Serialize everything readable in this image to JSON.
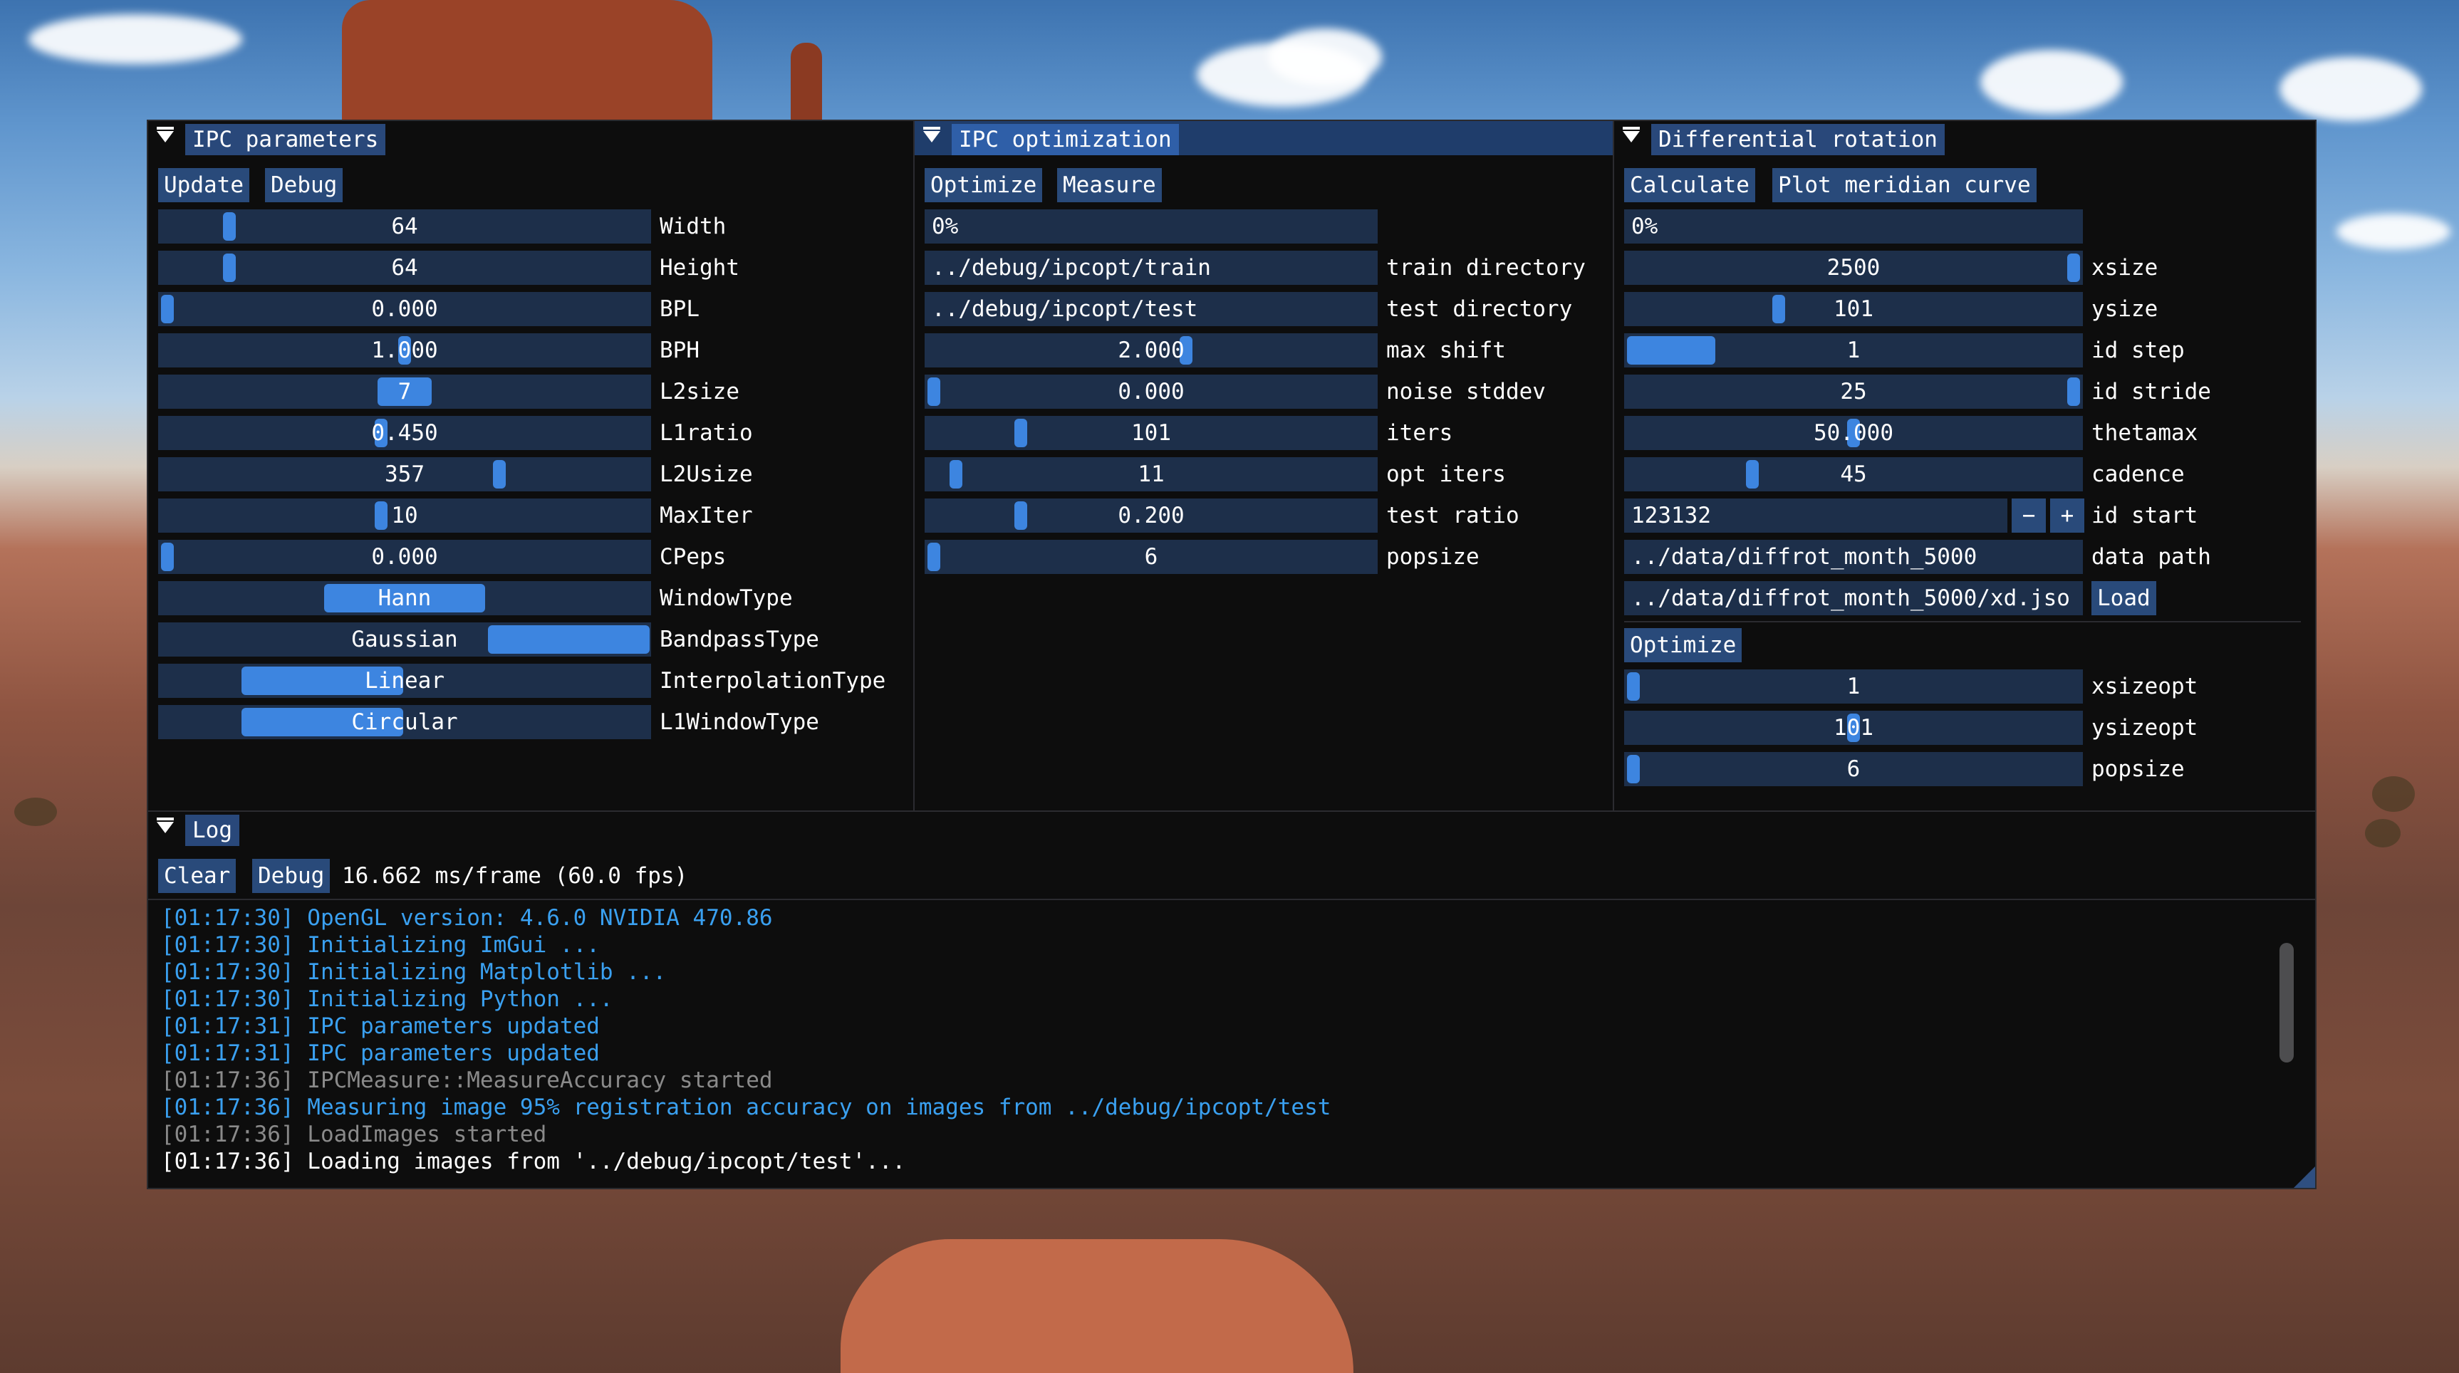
{
  "colors": {
    "accent": "#3d85e0",
    "frame": "#1d2f4a",
    "button": "#294a7a",
    "tab_active": "#2f5fa8",
    "log_info": "#3aa0f0",
    "log_gray": "#8a8a8a",
    "log_white": "#ffffff"
  },
  "ipc_parameters": {
    "title": "IPC parameters",
    "buttons": [
      "Update",
      "Debug"
    ],
    "rows": [
      {
        "value": "64",
        "label": "Width",
        "kind": "slider",
        "level": 0.13
      },
      {
        "value": "64",
        "label": "Height",
        "kind": "slider",
        "level": 0.13
      },
      {
        "value": "0.000",
        "label": "BPL",
        "kind": "slider",
        "level": 0.0
      },
      {
        "value": "1.000",
        "label": "BPH",
        "kind": "slider",
        "level": 0.5
      },
      {
        "value": "7",
        "label": "L2size",
        "kind": "combo_small",
        "level": 0.5
      },
      {
        "value": "0.450",
        "label": "L1ratio",
        "kind": "slider",
        "level": 0.45
      },
      {
        "value": "357",
        "label": "L2Usize",
        "kind": "slider",
        "level": 0.7
      },
      {
        "value": "10",
        "label": "MaxIter",
        "kind": "slider",
        "level": 0.45
      },
      {
        "value": "0.000",
        "label": "CPeps",
        "kind": "slider",
        "level": 0.0
      },
      {
        "value": "Hann",
        "label": "WindowType",
        "kind": "segment",
        "segment": 1
      },
      {
        "value": "Gaussian",
        "label": "BandpassType",
        "kind": "segment",
        "segment": 2
      },
      {
        "value": "Linear",
        "label": "InterpolationType",
        "kind": "segment",
        "segment": 0.5
      },
      {
        "value": "Circular",
        "label": "L1WindowType",
        "kind": "segment",
        "segment": 0.5
      }
    ]
  },
  "ipc_optimization": {
    "title": "IPC optimization",
    "buttons": [
      "Optimize",
      "Measure"
    ],
    "progress": "0%",
    "rows": [
      {
        "value": "../debug/ipcopt/train",
        "label": "train directory",
        "kind": "text"
      },
      {
        "value": "../debug/ipcopt/test",
        "label": "test directory",
        "kind": "text"
      },
      {
        "value": "2.000",
        "label": "max shift",
        "kind": "slider",
        "level": 0.58
      },
      {
        "value": "0.000",
        "label": "noise stddev",
        "kind": "slider",
        "level": 0.0
      },
      {
        "value": "101",
        "label": "iters",
        "kind": "slider",
        "level": 0.2
      },
      {
        "value": "11",
        "label": "opt iters",
        "kind": "slider",
        "level": 0.05
      },
      {
        "value": "0.200",
        "label": "test ratio",
        "kind": "slider",
        "level": 0.2
      },
      {
        "value": "6",
        "label": "popsize",
        "kind": "slider",
        "level": 0.0
      }
    ]
  },
  "differential_rotation": {
    "title": "Differential rotation",
    "buttons": [
      "Calculate",
      "Plot meridian curve"
    ],
    "progress": "0%",
    "rows": [
      {
        "value": "2500",
        "label": "xsize",
        "kind": "slider",
        "level": 1.0
      },
      {
        "value": "101",
        "label": "ysize",
        "kind": "slider",
        "level": 0.33
      },
      {
        "value": "1",
        "label": "id step",
        "kind": "wide_grab",
        "level": 0.0
      },
      {
        "value": "25",
        "label": "id stride",
        "kind": "slider",
        "level": 1.0
      },
      {
        "value": "50.000",
        "label": "thetamax",
        "kind": "slider",
        "level": 0.5
      },
      {
        "value": "45",
        "label": "cadence",
        "kind": "slider",
        "level": 0.27
      },
      {
        "value": "123132",
        "label": "id start",
        "kind": "stepper",
        "minus": "−",
        "plus": "+"
      },
      {
        "value": "../data/diffrot_month_5000",
        "label": "data path",
        "kind": "text"
      },
      {
        "value": "../data/diffrot_month_5000/xd.jso",
        "label": "Load",
        "kind": "text_button"
      }
    ],
    "optimize_button": "Optimize",
    "opt_rows": [
      {
        "value": "1",
        "label": "xsizeopt",
        "kind": "slider",
        "level": 0.0
      },
      {
        "value": "101",
        "label": "ysizeopt",
        "kind": "slider",
        "level": 0.5
      },
      {
        "value": "6",
        "label": "popsize",
        "kind": "slider",
        "level": 0.0
      }
    ]
  },
  "log": {
    "title": "Log",
    "buttons": [
      "Clear",
      "Debug"
    ],
    "fps": "16.662 ms/frame (60.0 fps)",
    "lines": [
      {
        "ts": "[01:17:30]",
        "text": "OpenGL version: 4.6.0 NVIDIA 470.86",
        "level": "info"
      },
      {
        "ts": "[01:17:30]",
        "text": "Initializing ImGui ...",
        "level": "info"
      },
      {
        "ts": "[01:17:30]",
        "text": "Initializing Matplotlib ...",
        "level": "info"
      },
      {
        "ts": "[01:17:30]",
        "text": "Initializing Python ...",
        "level": "info"
      },
      {
        "ts": "[01:17:31]",
        "text": "IPC parameters updated",
        "level": "info"
      },
      {
        "ts": "[01:17:31]",
        "text": "IPC parameters updated",
        "level": "info"
      },
      {
        "ts": "[01:17:36]",
        "text": "IPCMeasure::MeasureAccuracy started",
        "level": "debug"
      },
      {
        "ts": "[01:17:36]",
        "text": "Measuring image 95% registration accuracy on images from ../debug/ipcopt/test",
        "level": "info"
      },
      {
        "ts": "[01:17:36]",
        "text": "LoadImages started",
        "level": "debug"
      },
      {
        "ts": "[01:17:36]",
        "text": "Loading images from '../debug/ipcopt/test'...",
        "level": "plain"
      }
    ]
  }
}
